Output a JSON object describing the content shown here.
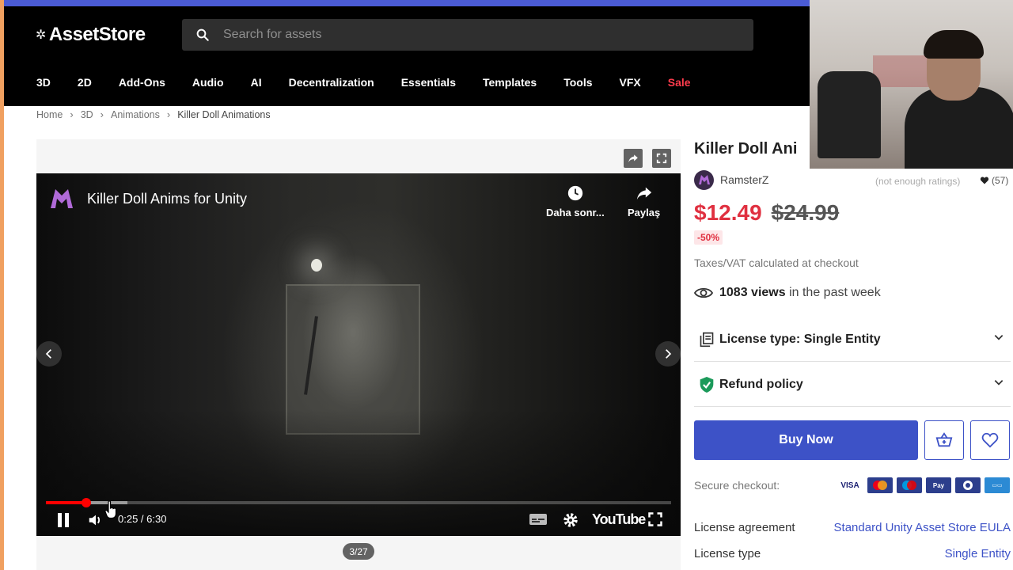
{
  "header": {
    "logo_text": "AssetStore",
    "search_placeholder": "Search for assets",
    "nav": [
      "3D",
      "2D",
      "Add-Ons",
      "Audio",
      "AI",
      "Decentralization",
      "Essentials",
      "Templates",
      "Tools",
      "VFX",
      "Sale"
    ]
  },
  "breadcrumb": [
    "Home",
    "3D",
    "Animations",
    "Killer Doll Animations"
  ],
  "video": {
    "title": "Killer Doll Anims for Unity",
    "watch_later": "Daha sonr...",
    "share": "Paylaş",
    "time": "0:25 / 6:30",
    "progress_fraction": 0.064,
    "buffered_fraction": 0.13,
    "youtube_label": "YouTube",
    "counter": "3/27"
  },
  "product": {
    "title": "Killer Doll Ani",
    "publisher": "RamsterZ",
    "ratings_note": "(not enough ratings)",
    "favorites": "(57)",
    "price_now": "$12.49",
    "price_was": "$24.99",
    "discount": "-50%",
    "tax_note": "Taxes/VAT calculated at checkout",
    "views_count": "1083 views",
    "views_suffix": "in the past week",
    "license_accordion": "License type: Single Entity",
    "refund_accordion": "Refund policy",
    "buy_label": "Buy Now",
    "secure_label": "Secure checkout:",
    "payment_methods": [
      "VISA",
      "Mastercard",
      "Maestro",
      "PayPal",
      "Diners",
      "Amex"
    ],
    "info": [
      {
        "key": "License agreement",
        "value": "Standard Unity Asset Store EULA"
      },
      {
        "key": "License type",
        "value": "Single Entity"
      }
    ]
  },
  "colors": {
    "accent": "#3d52c7",
    "sale": "#ff3c4d",
    "price": "#e03040",
    "topbar": "#4a5bd4"
  }
}
